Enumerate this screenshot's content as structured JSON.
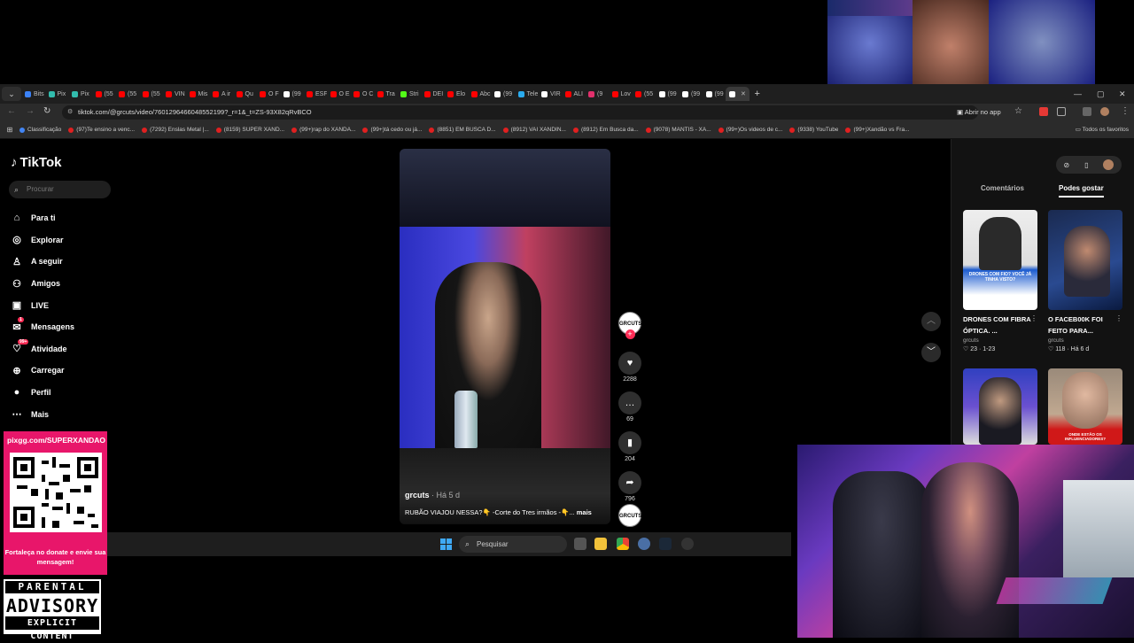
{
  "browser": {
    "tabs": [
      {
        "label": "Bits",
        "color": "#3b82f6"
      },
      {
        "label": "Pix",
        "color": "#32bcad"
      },
      {
        "label": "Pix",
        "color": "#32bcad"
      },
      {
        "label": "(55",
        "color": "#ff0000"
      },
      {
        "label": "(55",
        "color": "#ff0000"
      },
      {
        "label": "(55",
        "color": "#ff0000"
      },
      {
        "label": "VIN",
        "color": "#ff0000"
      },
      {
        "label": "Mis",
        "color": "#ff0000"
      },
      {
        "label": "A ir",
        "color": "#ff0000"
      },
      {
        "label": "Qu",
        "color": "#ff0000"
      },
      {
        "label": "O F",
        "color": "#ff0000"
      },
      {
        "label": "(99",
        "color": "#ffffff"
      },
      {
        "label": "ESF",
        "color": "#ff0000"
      },
      {
        "label": "O E",
        "color": "#ff0000"
      },
      {
        "label": "O C",
        "color": "#ff0000"
      },
      {
        "label": "Tra",
        "color": "#ff0000"
      },
      {
        "label": "Stri",
        "color": "#53fc18"
      },
      {
        "label": "DEI",
        "color": "#ff0000"
      },
      {
        "label": "Elo",
        "color": "#ff0000"
      },
      {
        "label": "Abc",
        "color": "#ff0000"
      },
      {
        "label": "(99",
        "color": "#ffffff"
      },
      {
        "label": "Tele",
        "color": "#2aabee"
      },
      {
        "label": "VIR",
        "color": "#ffffff"
      },
      {
        "label": "ALI",
        "color": "#ff0000"
      },
      {
        "label": "(9",
        "color": "#e1306c"
      },
      {
        "label": "Lov",
        "color": "#ff0000"
      },
      {
        "label": "(55",
        "color": "#ff0000"
      },
      {
        "label": "(99",
        "color": "#ffffff"
      },
      {
        "label": "(99",
        "color": "#ffffff"
      },
      {
        "label": "(99",
        "color": "#ffffff"
      },
      {
        "label": "",
        "color": "#ffffff"
      }
    ],
    "url": "tiktok.com/@grcuts/video/7601296466048552199?_r=1&_t=ZS-93X82qRvBCO",
    "open_in_app": "Abrir no app",
    "bookmarks": [
      "Classificação",
      "(97)Te ensino a venc...",
      "(7292) Enslas Metal |...",
      "(8159) SUPER XAND...",
      "(99+)rap do XANDÃ...",
      "(99+)tá cedo ou já...",
      "(8851) EM BUSCA D...",
      "(8912) VAI XANDIN...",
      "(8912) Em Busca da...",
      "(9078) MANTIS - XA...",
      "(99+)Os videos de c...",
      "(9338) YouTube",
      "(99+)Xandão vs Fra..."
    ],
    "all_favorites": "Todos os favoritos"
  },
  "tiktok": {
    "brand": "TikTok",
    "search_placeholder": "Procurar",
    "menu": [
      {
        "label": "Para ti",
        "icon": "home-icon",
        "glyph": "⌂"
      },
      {
        "label": "Explorar",
        "icon": "compass-icon",
        "glyph": "◎"
      },
      {
        "label": "A seguir",
        "icon": "follow-icon",
        "glyph": "♙"
      },
      {
        "label": "Amigos",
        "icon": "friends-icon",
        "glyph": "⚇"
      },
      {
        "label": "LIVE",
        "icon": "live-icon",
        "glyph": "▣"
      },
      {
        "label": "Mensagens",
        "icon": "messages-icon",
        "glyph": "✉",
        "badge": "1"
      },
      {
        "label": "Atividade",
        "icon": "activity-icon",
        "glyph": "♡",
        "badge": "99+"
      },
      {
        "label": "Carregar",
        "icon": "upload-icon",
        "glyph": "⊕"
      },
      {
        "label": "Perfil",
        "icon": "profile-icon",
        "glyph": "●"
      },
      {
        "label": "Mais",
        "icon": "more-icon",
        "glyph": "⋯"
      }
    ],
    "video": {
      "author": "grcuts",
      "ago": "· Há 5 d",
      "description": "RUBÃO VIAJOU NESSA?👇 -Corte do Tres irmãos -👇...",
      "more": "mais",
      "likes": "2288",
      "comments": "69",
      "saves": "204",
      "shares": "796",
      "avatar_text": "GRCUTS"
    },
    "right_tabs": {
      "comments": "Comentários",
      "you_may_like": "Podes gostar"
    },
    "suggestions": [
      {
        "title": "DRONES COM FIBRA ÓPTICA. ...",
        "author": "grcuts",
        "likes": "23",
        "date": "1-23",
        "caption": "DRONES COM FIO? VOCÊ JÁ TINHA VISTO?"
      },
      {
        "title": "O FACEB00K FOI FEITO PARA...",
        "author": "grcuts",
        "likes": "118",
        "date": "Há 6 d"
      },
      {
        "title": "",
        "author": "",
        "likes": "",
        "date": ""
      },
      {
        "title": "",
        "author": "",
        "likes": "",
        "date": "",
        "caption": "ONDE ESTÃO OS INFLUENCIADORES?"
      }
    ]
  },
  "overlay": {
    "donate_url": "pixgg.com/SUPERXANDAO",
    "donate_message": "Fortaleça no donate e envie sua mensagem!",
    "advisory_top": "PARENTAL",
    "advisory_mid": "ADVISORY",
    "advisory_bot": "EXPLICIT CONTENT"
  },
  "taskbar": {
    "search_placeholder": "Pesquisar"
  }
}
